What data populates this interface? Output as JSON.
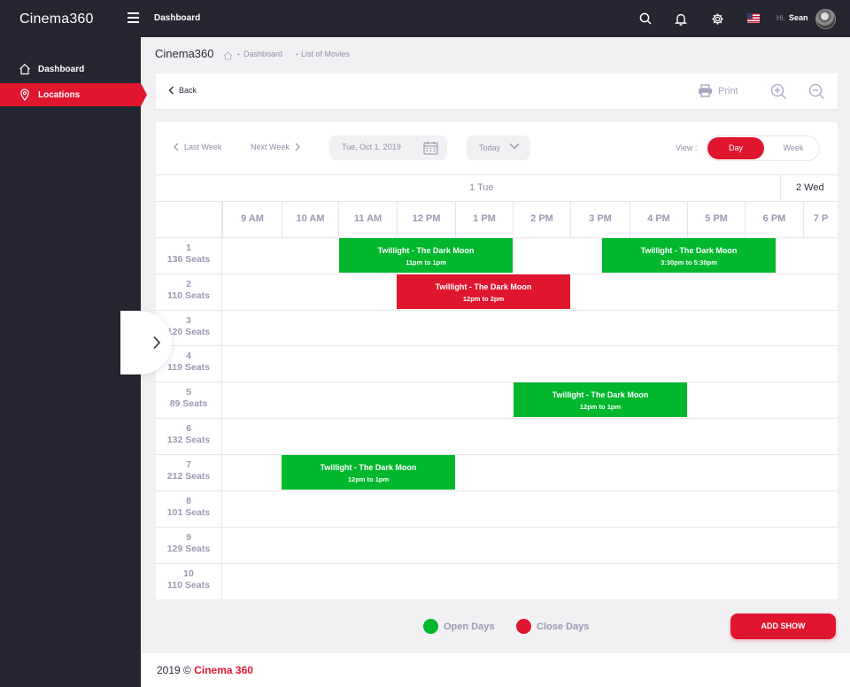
{
  "sidebar": {
    "logo": "Cinema360",
    "items": [
      {
        "label": "Dashboard"
      },
      {
        "label": "Locations"
      }
    ]
  },
  "topbar": {
    "title": "Dashboard",
    "greeting": "Hi,",
    "user_name": "Sean"
  },
  "breadcrumb": {
    "app": "Cinema360",
    "links": [
      "Dashboard",
      "List of Movies"
    ]
  },
  "actions": {
    "back": "Back",
    "print": "Print"
  },
  "calendar": {
    "last_week": "Last Week",
    "next_week": "Next Week",
    "date": "Tue, Oct 1, 2019",
    "today": "Today",
    "view_label": "View :",
    "view_day": "Day",
    "view_week": "Week",
    "day_label": "1 Tue",
    "next_day_label": "2 Wed",
    "hours": [
      "9 AM",
      "10 AM",
      "11 AM",
      "12 PM",
      "1 PM",
      "2 PM",
      "3 PM",
      "4 PM",
      "5 PM",
      "6 PM",
      "7 P"
    ],
    "rows": [
      {
        "num": "1",
        "seats": "136 Seats"
      },
      {
        "num": "2",
        "seats": "110 Seats"
      },
      {
        "num": "3",
        "seats": "120 Seats"
      },
      {
        "num": "4",
        "seats": "119 Seats"
      },
      {
        "num": "5",
        "seats": "89 Seats"
      },
      {
        "num": "6",
        "seats": "132 Seats"
      },
      {
        "num": "7",
        "seats": "212 Seats"
      },
      {
        "num": "8",
        "seats": "101 Seats"
      },
      {
        "num": "9",
        "seats": "129 Seats"
      },
      {
        "num": "10",
        "seats": "110 Seats"
      }
    ],
    "events": [
      {
        "row": 0,
        "title": "Twillight - The Dark Moon",
        "time": "11pm to 1pm",
        "status": "open"
      },
      {
        "row": 0,
        "title": "Twillight - The Dark Moon",
        "time": "3:30pm to 5:30pm",
        "status": "open"
      },
      {
        "row": 1,
        "title": "Twillight - The Dark Moon",
        "time": "12pm to 2pm",
        "status": "close"
      },
      {
        "row": 4,
        "title": "Twillight - The Dark Moon",
        "time": "12pm to 1pm",
        "status": "open"
      },
      {
        "row": 6,
        "title": "Twillight - The Dark Moon",
        "time": "12pm to 1pm",
        "status": "open"
      }
    ]
  },
  "legend": {
    "open": "Open Days",
    "close": "Close Days"
  },
  "add_show": "ADD SHOW",
  "footer": {
    "year": "2019 ©",
    "brand": "Cinema 360"
  },
  "colors": {
    "accent": "#e0162f",
    "open": "#00b72d",
    "sidebar": "#262632"
  }
}
